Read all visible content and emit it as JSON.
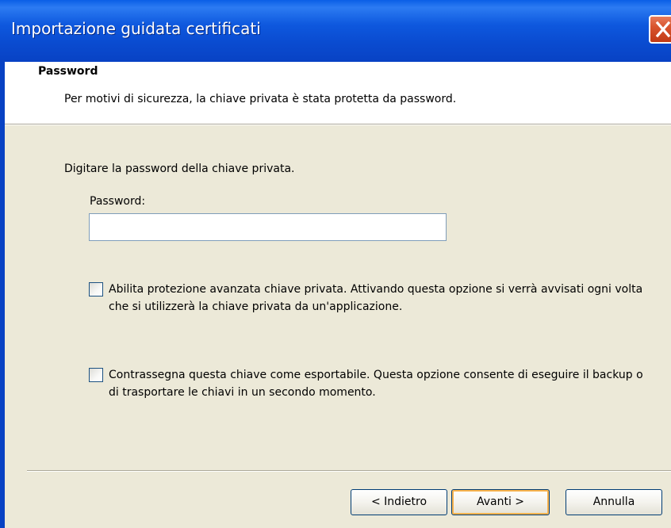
{
  "window": {
    "title": "Importazione guidata certificati"
  },
  "header": {
    "section_title": "Password",
    "section_description": "Per motivi di sicurezza, la chiave privata è stata protetta da password."
  },
  "form": {
    "instruction": "Digitare la password della chiave privata.",
    "password_label": "Password:",
    "password_value": "",
    "checkboxes": [
      {
        "label": "Abilita protezione avanzata chiave privata. Attivando questa opzione si verrà avvisati ogni volta che si utilizzerà la chiave privata da un'applicazione.",
        "checked": false
      },
      {
        "label": "Contrassegna questa chiave come esportabile. Questa opzione consente di eseguire il backup o di trasportare le chiavi in un secondo momento.",
        "checked": false
      }
    ]
  },
  "buttons": {
    "back_label": "< Indietro",
    "next_label": "Avanti >",
    "cancel_label": "Annulla"
  },
  "icons": {
    "close": "close-icon"
  },
  "colors": {
    "titlebar": "#0A4BD0",
    "dialog_bg": "#ECE9D8",
    "header_bg": "#FFFFFF",
    "close_button": "#D8542E",
    "default_button_focus": "#F8B34E"
  }
}
